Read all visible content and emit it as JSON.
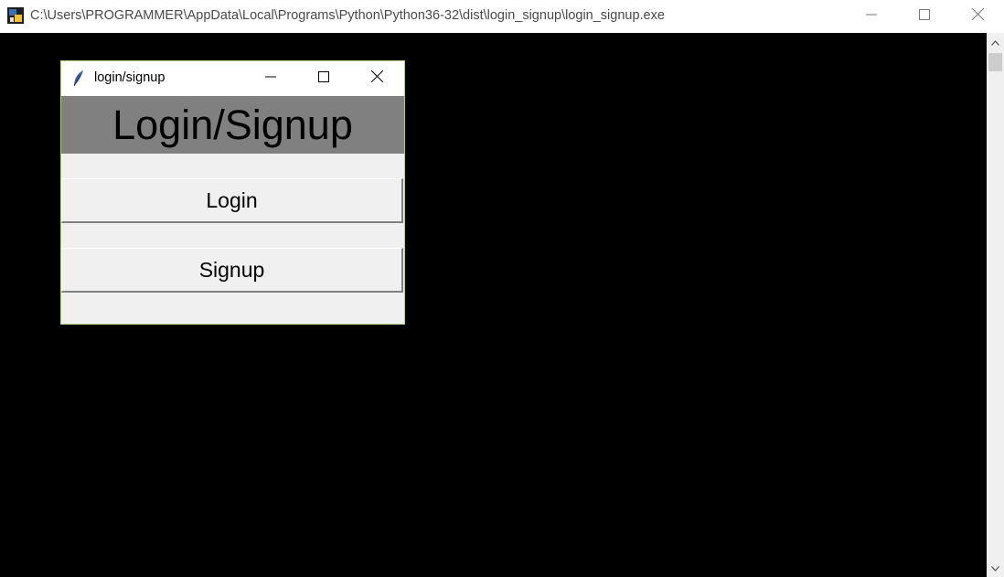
{
  "console_window": {
    "title": "C:\\Users\\PROGRAMMER\\AppData\\Local\\Programs\\Python\\Python36-32\\dist\\login_signup\\login_signup.exe",
    "icon": "python-app-icon",
    "controls": [
      "minimize-icon",
      "maximize-icon",
      "close-icon"
    ]
  },
  "tk_window": {
    "title": "login/signup",
    "icon": "feather-icon",
    "header": "Login/Signup",
    "buttons": {
      "login": "Login",
      "signup": "Signup"
    }
  },
  "colors": {
    "console_background": "#000000",
    "header_background": "#808080",
    "window_background": "#f0f0f0",
    "window_border": "#b4cf8c"
  }
}
